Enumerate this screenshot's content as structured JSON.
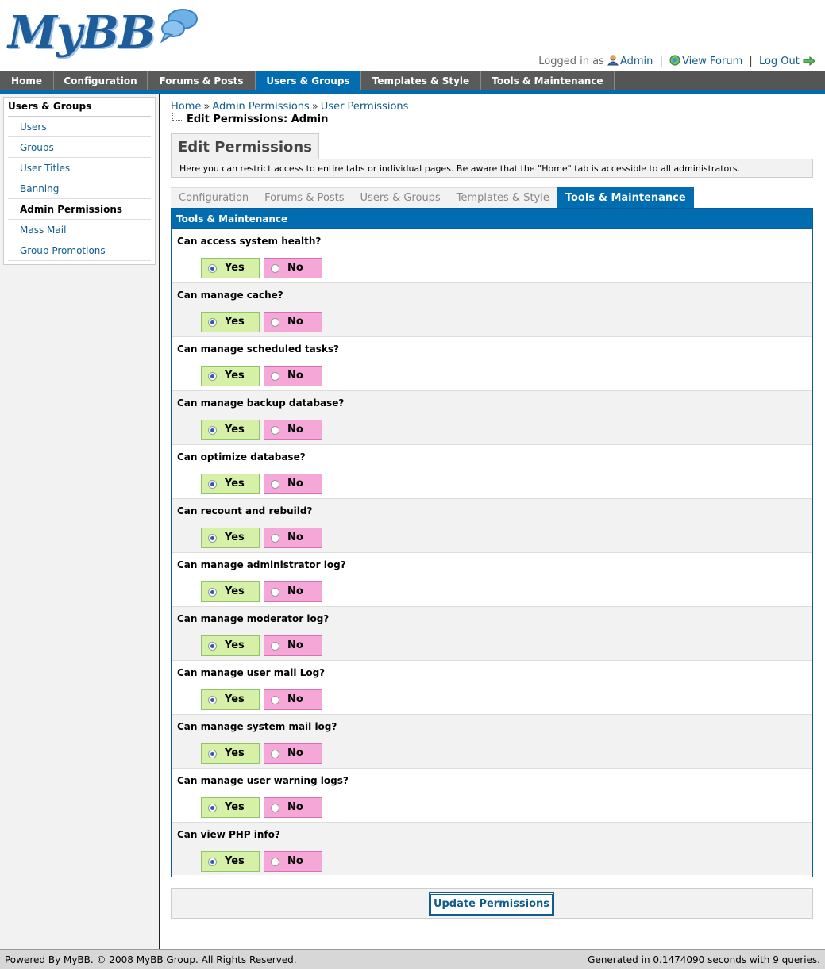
{
  "header": {
    "logo_text": "MyBB",
    "logged_in_label": "Logged in as",
    "username": "Admin",
    "view_forum": "View Forum",
    "logout": "Log Out"
  },
  "menu": {
    "items": [
      "Home",
      "Configuration",
      "Forums & Posts",
      "Users & Groups",
      "Templates & Style",
      "Tools & Maintenance"
    ],
    "active_index": 3
  },
  "sidebar": {
    "title": "Users & Groups",
    "items": [
      "Users",
      "Groups",
      "User Titles",
      "Banning",
      "Admin Permissions",
      "Mass Mail",
      "Group Promotions"
    ],
    "active_index": 4
  },
  "breadcrumb": {
    "items": [
      "Home",
      "Admin Permissions",
      "User Permissions"
    ],
    "current": "Edit Permissions: Admin"
  },
  "page": {
    "title": "Edit Permissions",
    "description": "Here you can restrict access to entire tabs or individual pages. Be aware that the \"Home\" tab is accessible to all administrators."
  },
  "tabs": {
    "items": [
      "Configuration",
      "Forums & Posts",
      "Users & Groups",
      "Templates & Style",
      "Tools & Maintenance"
    ],
    "active_index": 4
  },
  "table": {
    "header": "Tools & Maintenance",
    "yes_label": "Yes",
    "no_label": "No",
    "rows": [
      {
        "question": "Can access system health?",
        "value": "Yes"
      },
      {
        "question": "Can manage cache?",
        "value": "Yes"
      },
      {
        "question": "Can manage scheduled tasks?",
        "value": "Yes"
      },
      {
        "question": "Can manage backup database?",
        "value": "Yes"
      },
      {
        "question": "Can optimize database?",
        "value": "Yes"
      },
      {
        "question": "Can recount and rebuild?",
        "value": "Yes"
      },
      {
        "question": "Can manage administrator log?",
        "value": "Yes"
      },
      {
        "question": "Can manage moderator log?",
        "value": "Yes"
      },
      {
        "question": "Can manage user mail Log?",
        "value": "Yes"
      },
      {
        "question": "Can manage system mail log?",
        "value": "Yes"
      },
      {
        "question": "Can manage user warning logs?",
        "value": "Yes"
      },
      {
        "question": "Can view PHP info?",
        "value": "Yes"
      }
    ]
  },
  "form": {
    "submit_label": "Update Permissions"
  },
  "footer": {
    "left": "Powered By MyBB. © 2008 MyBB Group. All Rights Reserved.",
    "right": "Generated in 0.1474090 seconds with 9 queries."
  },
  "colors": {
    "accent": "#026cb1",
    "link": "#0f5c8e",
    "yes_bg": "#d6f0a8",
    "no_bg": "#f5a8d8"
  }
}
